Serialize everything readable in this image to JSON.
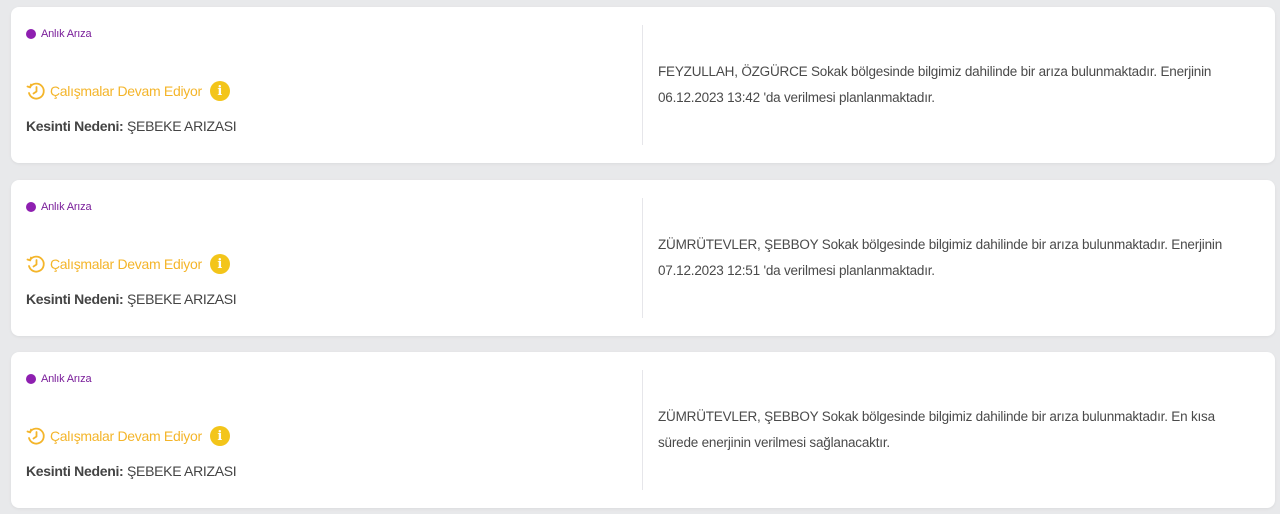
{
  "colors": {
    "badge_dot": "#8e1fb0",
    "status_orange": "#f4b52a",
    "info_yellow": "#f3c51a"
  },
  "cards": [
    {
      "badge": "Anlık Arıza",
      "status": "Çalışmalar Devam Ediyor",
      "status_icon": "clock-rotate-icon",
      "info_icon": "info-icon",
      "info_glyph": "i",
      "reason_label": "Kesinti Nedeni:",
      "reason_value": "ŞEBEKE ARIZASI",
      "description": "FEYZULLAH, ÖZGÜRCE Sokak bölgesinde bilgimiz dahilinde bir arıza bulunmaktadır. Enerjinin 06.12.2023 13:42 'da verilmesi planlanmaktadır."
    },
    {
      "badge": "Anlık Arıza",
      "status": "Çalışmalar Devam Ediyor",
      "status_icon": "clock-rotate-icon",
      "info_icon": "info-icon",
      "info_glyph": "i",
      "reason_label": "Kesinti Nedeni:",
      "reason_value": "ŞEBEKE ARIZASI",
      "description": "ZÜMRÜTEVLER, ŞEBBOY Sokak bölgesinde bilgimiz dahilinde bir arıza bulunmaktadır. Enerjinin 07.12.2023 12:51 'da verilmesi planlanmaktadır."
    },
    {
      "badge": "Anlık Arıza",
      "status": "Çalışmalar Devam Ediyor",
      "status_icon": "clock-rotate-icon",
      "info_icon": "info-icon",
      "info_glyph": "i",
      "reason_label": "Kesinti Nedeni:",
      "reason_value": "ŞEBEKE ARIZASI",
      "description": "ZÜMRÜTEVLER, ŞEBBOY Sokak bölgesinde bilgimiz dahilinde bir arıza bulunmaktadır. En kısa sürede enerjinin verilmesi sağlanacaktır."
    }
  ]
}
